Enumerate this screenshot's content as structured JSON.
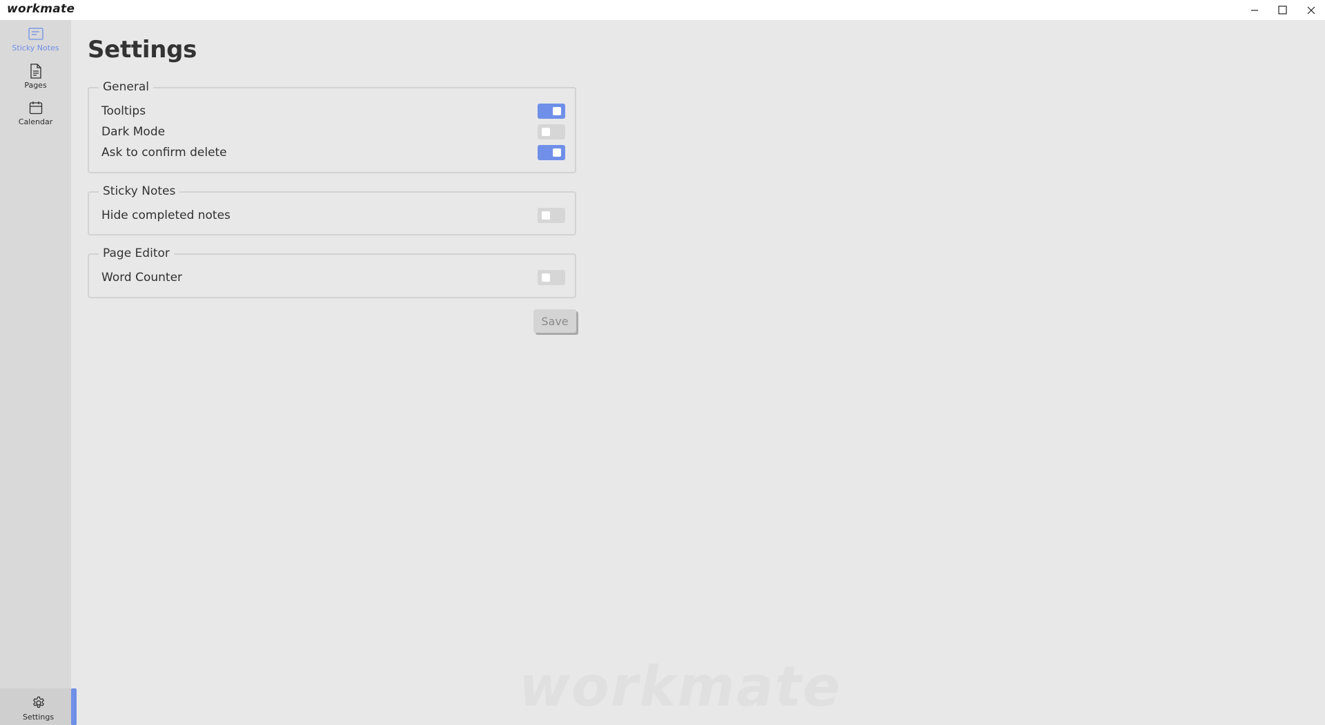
{
  "app": {
    "title": "workmate",
    "watermark": "workmate"
  },
  "window_controls": {
    "minimize_icon": "minimize-icon",
    "maximize_icon": "maximize-icon",
    "close_icon": "close-icon"
  },
  "sidebar": {
    "items": [
      {
        "label": "Sticky Notes",
        "icon": "sticky-notes-icon",
        "active": true
      },
      {
        "label": "Pages",
        "icon": "page-icon",
        "active": false
      },
      {
        "label": "Calendar",
        "icon": "calendar-icon",
        "active": false
      }
    ],
    "settings": {
      "label": "Settings",
      "icon": "gear-icon",
      "selected": true
    }
  },
  "page": {
    "title": "Settings"
  },
  "groups": [
    {
      "legend": "General",
      "settings": [
        {
          "label": "Tooltips",
          "enabled": true
        },
        {
          "label": "Dark Mode",
          "enabled": false
        },
        {
          "label": "Ask to confirm delete",
          "enabled": true
        }
      ]
    },
    {
      "legend": "Sticky Notes",
      "settings": [
        {
          "label": "Hide completed notes",
          "enabled": false
        }
      ]
    },
    {
      "legend": "Page Editor",
      "settings": [
        {
          "label": "Word Counter",
          "enabled": false
        }
      ]
    }
  ],
  "actions": {
    "save_label": "Save"
  },
  "colors": {
    "accent": "#6f8fe8",
    "toggle_off": "#d6d6d6",
    "sidebar_bg": "#d9d9d9",
    "content_bg": "#e8e8e8"
  }
}
